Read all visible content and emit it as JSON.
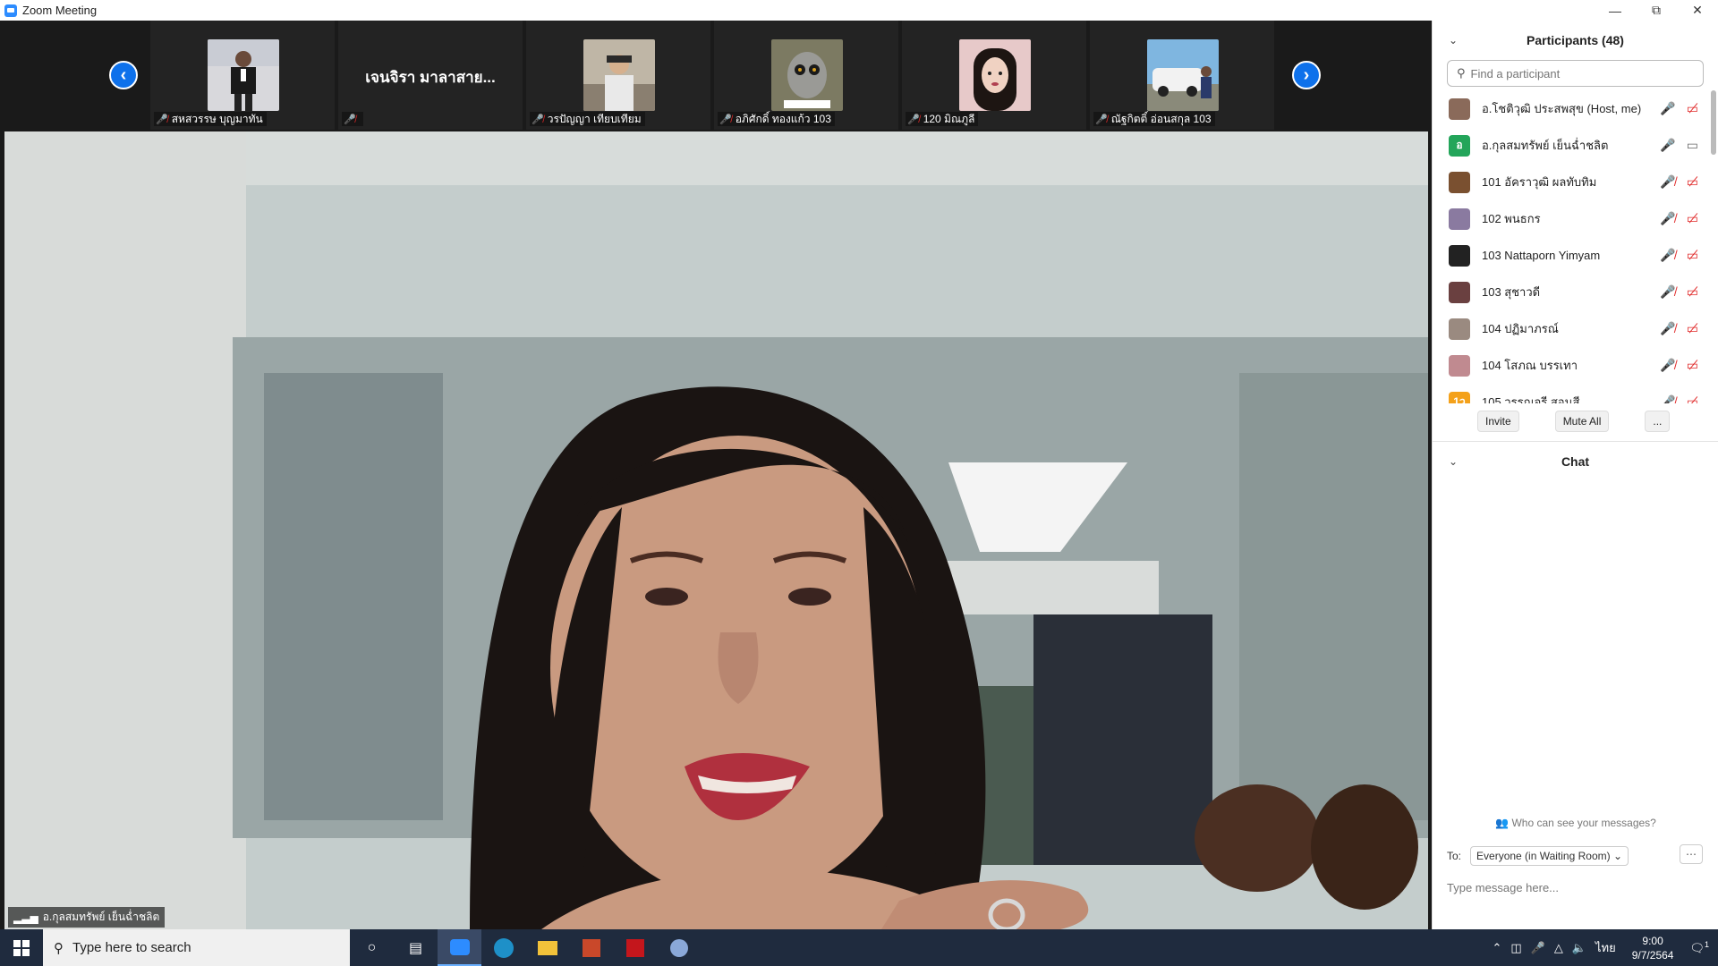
{
  "window": {
    "title": "Zoom Meeting",
    "minimize": "—",
    "restore": "⧉",
    "close": "✕"
  },
  "gallery": {
    "prev": "‹",
    "next": "›",
    "tiles": [
      {
        "name": "สหสวรรษ บุญมาทัน",
        "big_name": ""
      },
      {
        "name": "",
        "big_name": "เจนจิรา มาลาสาย..."
      },
      {
        "name": "วรปัญญา เทียบเทียม",
        "big_name": ""
      },
      {
        "name": "อภิศักดิ์ ทองแก้ว 103",
        "big_name": ""
      },
      {
        "name": "120 มิณภูลี",
        "big_name": ""
      },
      {
        "name": "ณัฐกิตติ์ อ่อนสกุล 103",
        "big_name": ""
      }
    ]
  },
  "speaker": {
    "name": "อ.กุลสมทรัพย์ เย็นฉ่ำชลิต"
  },
  "participants": {
    "header": "Participants (48)",
    "search_placeholder": "Find a participant",
    "list": [
      {
        "name": "อ.โชติวุฒิ ประสพสุข (Host, me)",
        "initials": "",
        "color": "#8a6a5a",
        "mic": "on",
        "video": "off"
      },
      {
        "name": "อ.กุลสมทรัพย์ เย็นฉ่ำชลิต",
        "initials": "อ",
        "color": "#23a55a",
        "mic": "on",
        "video": "on"
      },
      {
        "name": "101 อัคราวุฒิ ผลทับทิม",
        "initials": "",
        "color": "#7a5030",
        "mic": "off",
        "video": "off"
      },
      {
        "name": "102 พนธกร",
        "initials": "",
        "color": "#8a7aa0",
        "mic": "off",
        "video": "off"
      },
      {
        "name": "103 Nattaporn Yimyam",
        "initials": "",
        "color": "#222222",
        "mic": "off",
        "video": "off"
      },
      {
        "name": "103 สุชาวดี",
        "initials": "",
        "color": "#6a4040",
        "mic": "off",
        "video": "off"
      },
      {
        "name": "104 ปฏิมาภรณ์",
        "initials": "",
        "color": "#9a8a80",
        "mic": "off",
        "video": "off"
      },
      {
        "name": "104 โสภณ บรรเทา",
        "initials": "",
        "color": "#c08a90",
        "mic": "off",
        "video": "off"
      },
      {
        "name": "105 วรรณจรี สอนสี",
        "initials": "1ว",
        "color": "#f4a11a",
        "mic": "off",
        "video": "off"
      }
    ],
    "invite": "Invite",
    "mute_all": "Mute All",
    "more": "..."
  },
  "chat": {
    "header": "Chat",
    "who_can_see": "Who can see your messages?",
    "to_label": "To:",
    "to_value": "Everyone (in Waiting Room)",
    "more": "⋯",
    "placeholder": "Type message here..."
  },
  "taskbar": {
    "search_text": "Type here to search",
    "lang": "ไทย",
    "time": "9:00",
    "date": "9/7/2564",
    "notif_count": "1"
  }
}
